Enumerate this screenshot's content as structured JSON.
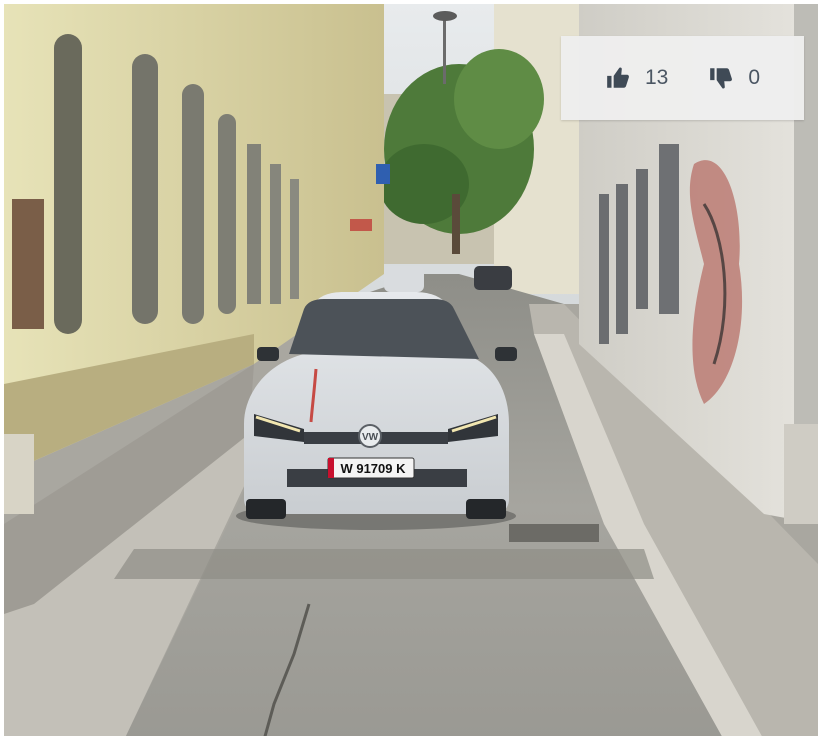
{
  "photo": {
    "subject": "street-scene-with-car",
    "plate_text": "W 91709 K",
    "brand_badge": "VW"
  },
  "votes": {
    "up_count": "13",
    "down_count": "0",
    "up_icon": "thumbs-up-icon",
    "down_icon": "thumbs-down-icon"
  }
}
